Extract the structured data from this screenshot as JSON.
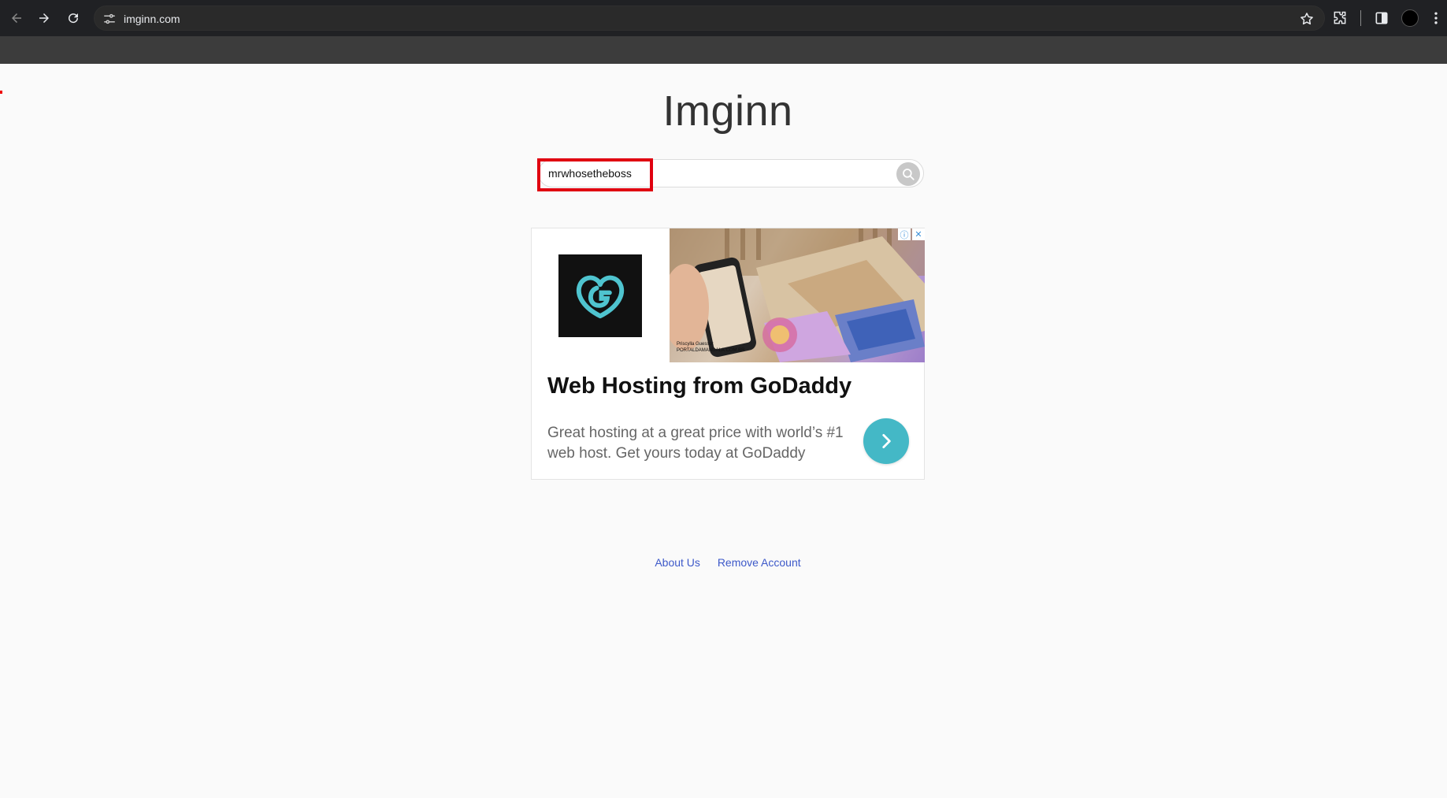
{
  "browser": {
    "url": "imginn.com",
    "icons": [
      "back-arrow-icon",
      "forward-arrow-icon",
      "reload-icon",
      "site-settings-icon",
      "bookmark-star-icon",
      "extensions-puzzle-icon",
      "side-panel-icon",
      "profile-avatar",
      "more-vert-icon"
    ]
  },
  "page": {
    "title": "Imginn"
  },
  "search": {
    "value": "mrwhosetheboss",
    "placeholder": ""
  },
  "ad": {
    "brand_colors": {
      "accent": "#44b8c6",
      "logo_bg": "#111111"
    },
    "photo_caption_line1": "Priscylla Guessor",
    "photo_caption_line2": "PORTALDAMANDALA.COM.BR",
    "headline": "Web Hosting from GoDaddy",
    "body": "Great hosting at a great price with world’s #1 web host. Get yours today at GoDaddy",
    "badge_info": "ⓘ",
    "badge_close": "✕"
  },
  "footer": {
    "links": [
      {
        "label": "About Us"
      },
      {
        "label": "Remove Account"
      }
    ]
  },
  "colors": {
    "highlight": "#e00010",
    "link": "#3d59c9",
    "page_bg": "#fafafa"
  }
}
